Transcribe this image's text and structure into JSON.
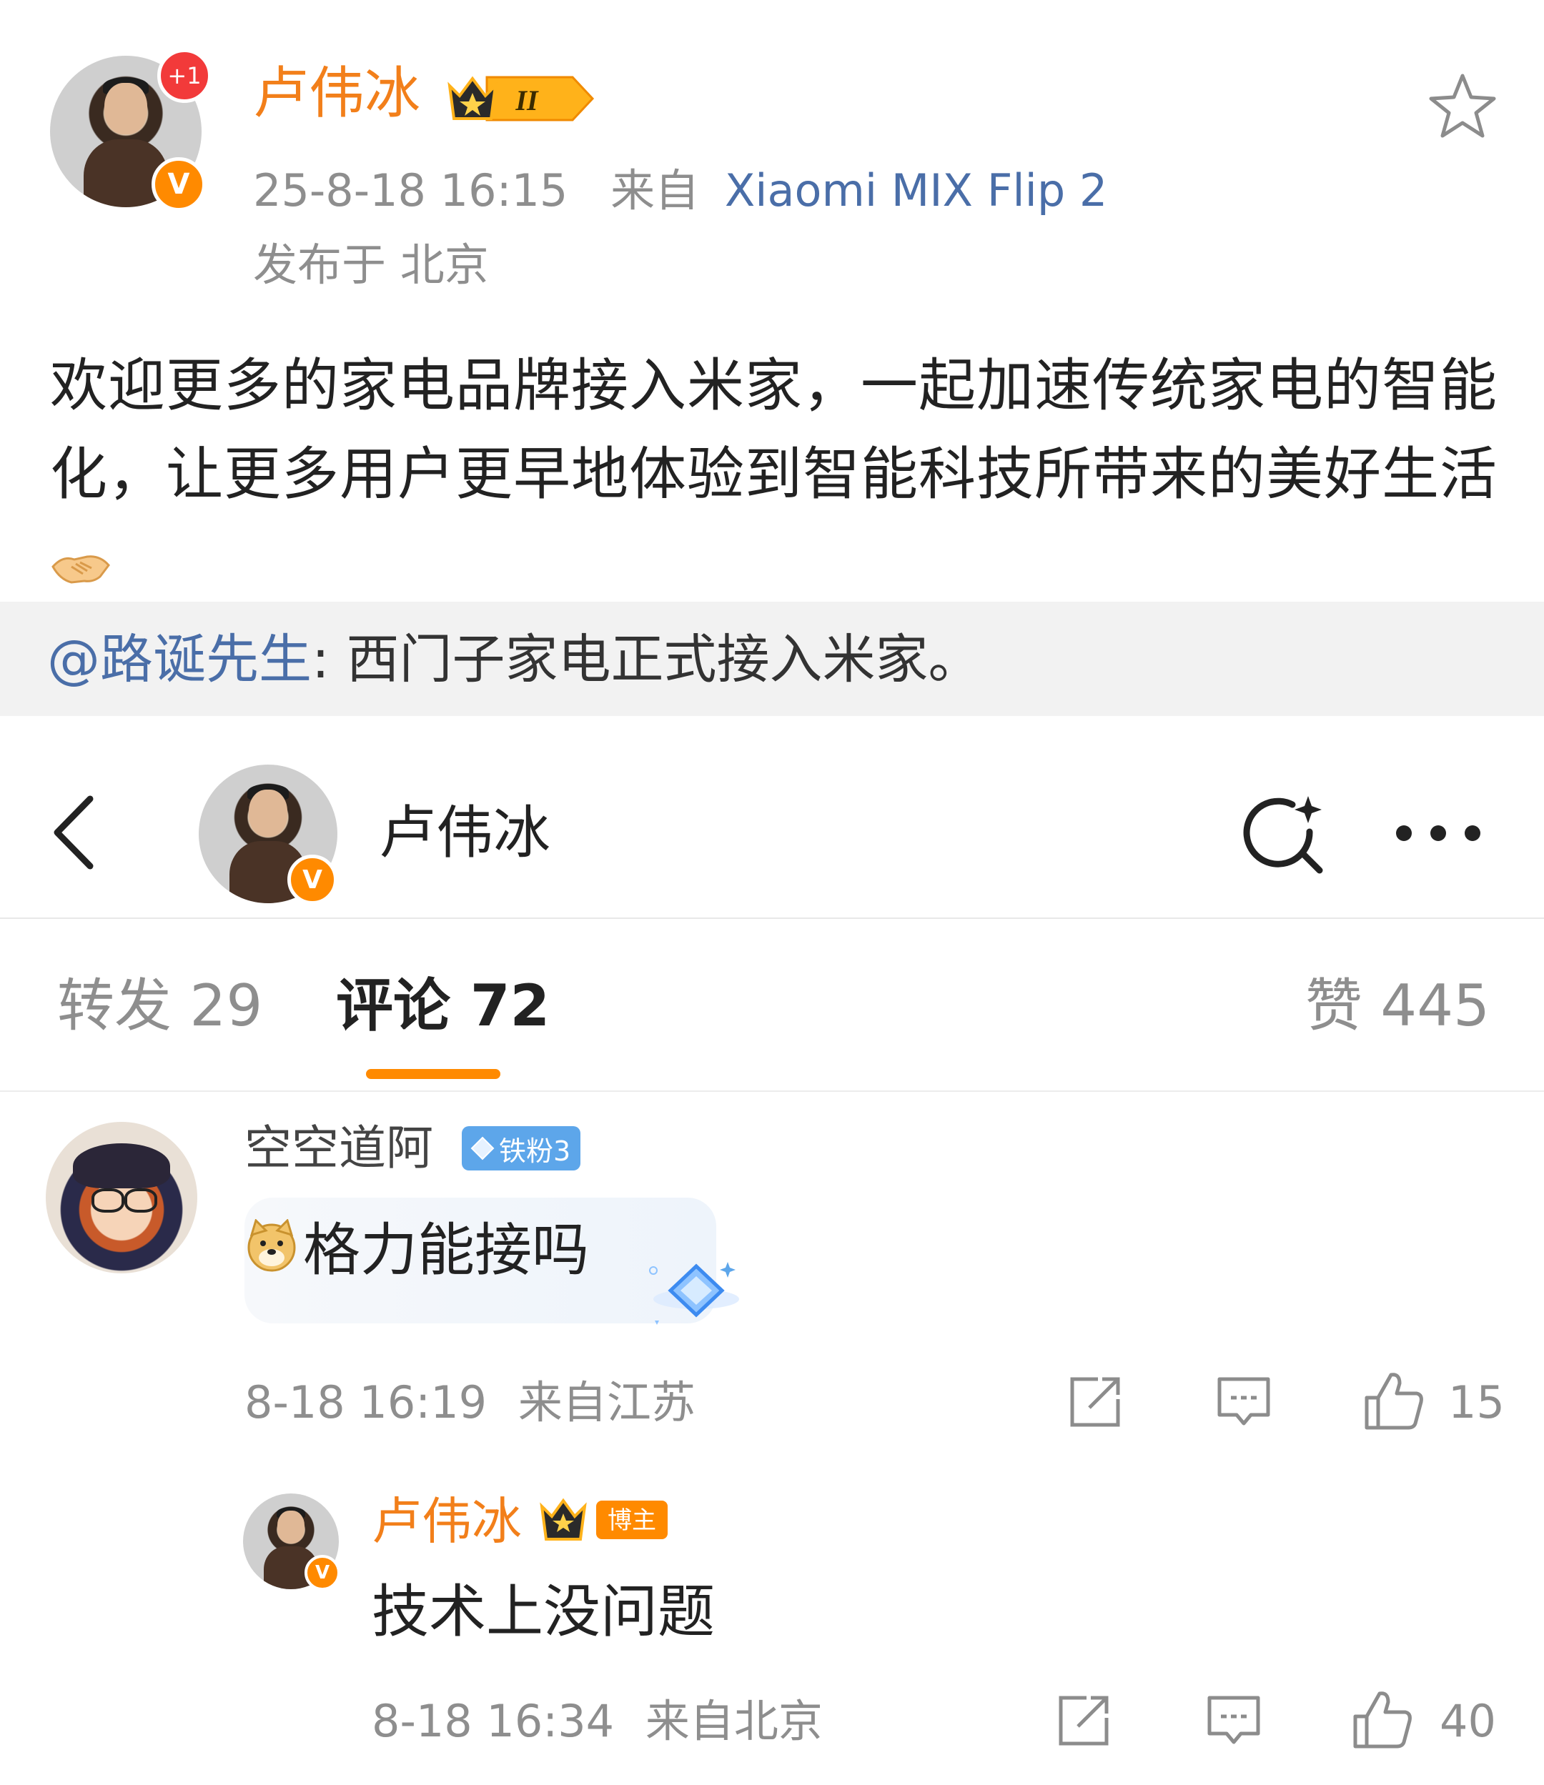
{
  "post": {
    "author": "卢伟冰",
    "follow_plus": "+1",
    "level_badge": "II",
    "verified_mark": "V",
    "time": "25-8-18 16:15",
    "source_prefix": "来自",
    "source": "Xiaomi MIX Flip 2",
    "location": "发布于 北京",
    "text": "欢迎更多的家电品牌接入米家，一起加速传统家电的智能化，让更多用户更早地体验到智能科技所带来的美好生活",
    "emoji": "handshake-icon",
    "repost": {
      "mention": "@路诞先生",
      "text": ": 西门子家电正式接入米家。"
    }
  },
  "nav": {
    "name": "卢伟冰",
    "verified_mark": "V"
  },
  "tabs": {
    "repost": "转发 29",
    "comment": "评论 72",
    "like": "赞 445"
  },
  "comments": [
    {
      "user": "空空道阿",
      "fan_badge": "铁粉3",
      "text": "格力能接吗",
      "time": "8-18 16:19",
      "from": "来自江苏",
      "likes": "15",
      "emoji": "doge-icon"
    },
    {
      "user": "卢伟冰",
      "author_badge": "博主",
      "text": "技术上没问题",
      "time": "8-18 16:34",
      "from": "来自北京",
      "likes": "40",
      "verified_mark": "V"
    }
  ],
  "colors": {
    "accent_orange": "#ff8a00",
    "author_name": "#f27f1a",
    "link_blue": "#4a6ea8",
    "meta_gray": "#8e8e8e",
    "fan_badge_blue": "#5da6ea"
  }
}
